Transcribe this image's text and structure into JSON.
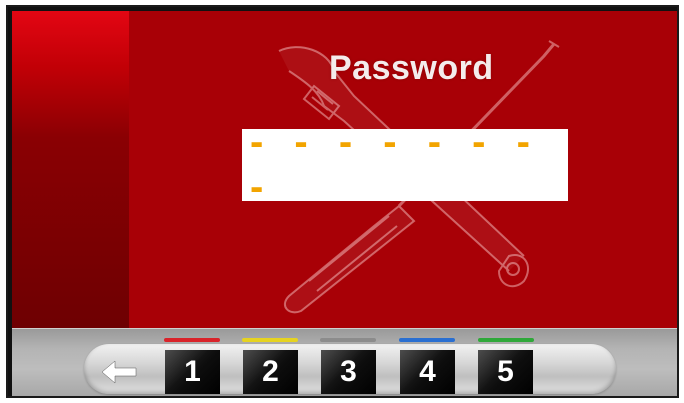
{
  "screen": {
    "title": "Password",
    "password_mask": "- - - - - - - -",
    "colors": {
      "left_panel": "#8a0003",
      "main_panel": "#a80006",
      "mask": "#f2a400"
    }
  },
  "keypad": {
    "back_icon": "arrow-left-icon",
    "keys": [
      {
        "label": "1",
        "indicator_color": "#d9232a"
      },
      {
        "label": "2",
        "indicator_color": "#e6d320"
      },
      {
        "label": "3",
        "indicator_color": "#8c8c8c"
      },
      {
        "label": "4",
        "indicator_color": "#2a6fd1"
      },
      {
        "label": "5",
        "indicator_color": "#2fa83a"
      }
    ]
  },
  "decoration": {
    "background_icon": "wrench-screwdriver-icon"
  }
}
